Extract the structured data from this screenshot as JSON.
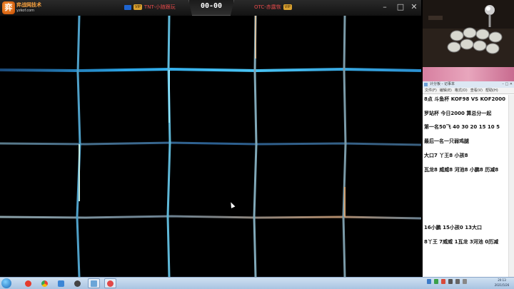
{
  "app": {
    "logo_char": "弈",
    "name": "弈战网技术",
    "url": "yzkof.com"
  },
  "match": {
    "score": "00-00",
    "player1": {
      "name": "TNT-小随跟玩",
      "badge": "VIP"
    },
    "player2": {
      "name": "OTC-赤露恢",
      "badge": "VIP"
    }
  },
  "window_controls": {
    "minimize": "–",
    "maximize": "□",
    "close": "✕"
  },
  "notepad": {
    "title": "计分板 - 记事本",
    "menus": [
      "文件(F)",
      "编辑(E)",
      "格式(O)",
      "查看(V)",
      "帮助(H)"
    ],
    "lines": [
      "8点 斗鱼杯 KOF98 VS KOF2000",
      "罗站杯 今日2000  算总分一起",
      "第一名50飞 40 30 20 15  10 5",
      "最后一名一只弱鸡腿",
      "大口7 丫王8 小孩8",
      "瓦龙8 威威8 河池8 小鹏8 历减8",
      "16小鹏 15小孩0 13大口",
      "8丫王 7威威 1瓦龙 3河池 0历减"
    ]
  },
  "taskbar": {
    "clock_time": "20:13",
    "clock_date": "2021/5/26",
    "items": [
      {
        "icon": "qq-penguin-icon",
        "color": "#e43b2c"
      },
      {
        "icon": "chrome-icon",
        "color": "#f0b400"
      },
      {
        "icon": "app-icon",
        "color": "#3b86d6"
      },
      {
        "icon": "media-icon",
        "color": "#444444"
      },
      {
        "icon": "folder-icon",
        "color": "#6aa5d8"
      },
      {
        "icon": "game-icon",
        "color": "#e04848"
      }
    ]
  },
  "colors": {
    "grid_blue": "#2aa4e6",
    "grid_dark": "#1b4a7a",
    "accent_orange": "#ffa640"
  }
}
